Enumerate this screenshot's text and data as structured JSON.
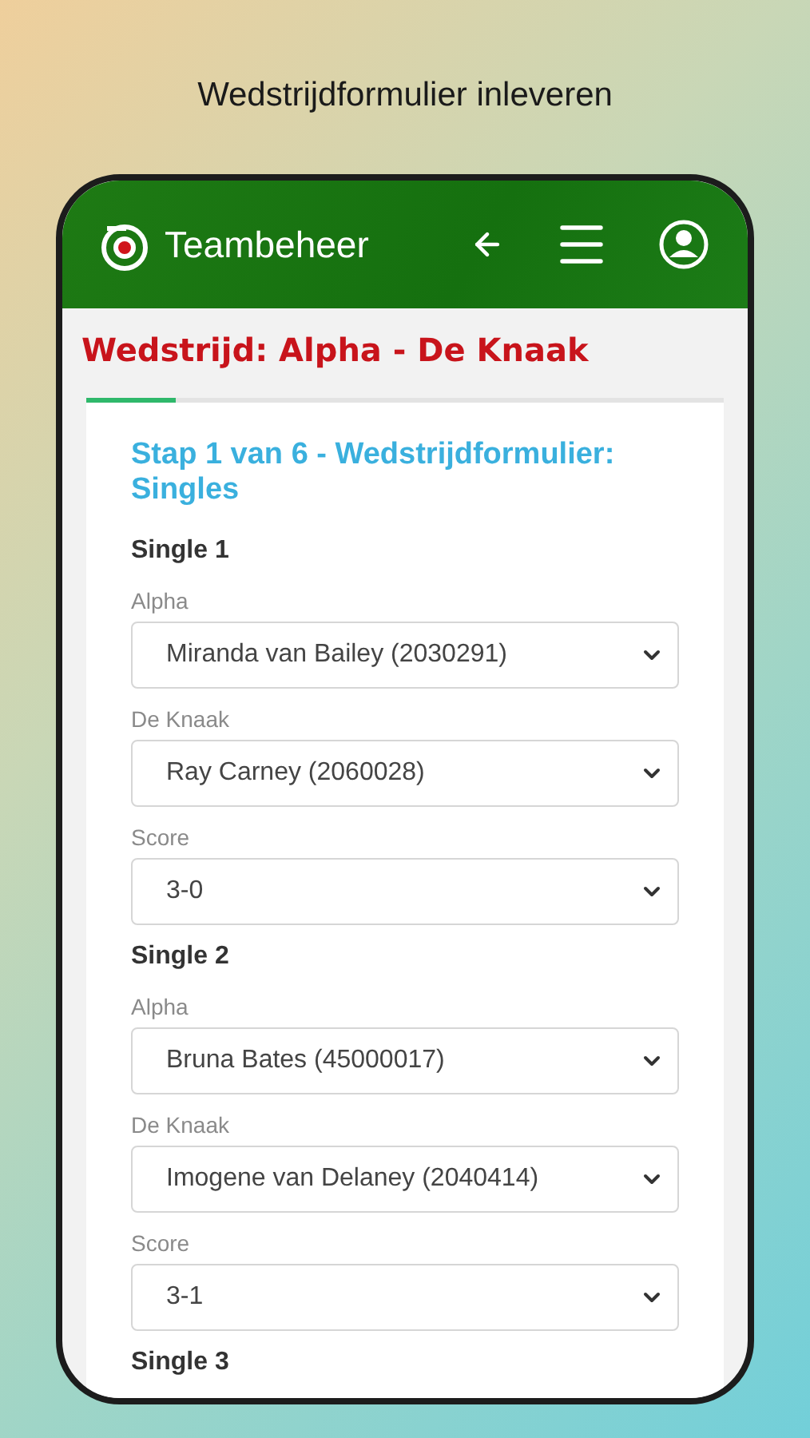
{
  "caption": "Wedstrijdformulier inleveren",
  "header": {
    "brand": "Teambeheer"
  },
  "match_title": "Wedstrijd: Alpha - De Knaak",
  "progress": {
    "level": 0.14
  },
  "step_title": "Stap 1 van 6 - Wedstrijdformulier: Singles",
  "singles": [
    {
      "title": "Single 1",
      "fields": [
        {
          "label": "Alpha",
          "value": "Miranda van Bailey (2030291)"
        },
        {
          "label": "De Knaak",
          "value": "Ray Carney (2060028)"
        },
        {
          "label": "Score",
          "value": "3-0"
        }
      ]
    },
    {
      "title": "Single 2",
      "fields": [
        {
          "label": "Alpha",
          "value": "Bruna Bates (45000017)"
        },
        {
          "label": "De Knaak",
          "value": "Imogene van Delaney (2040414)"
        },
        {
          "label": "Score",
          "value": "3-1"
        }
      ]
    },
    {
      "title": "Single 3"
    }
  ]
}
